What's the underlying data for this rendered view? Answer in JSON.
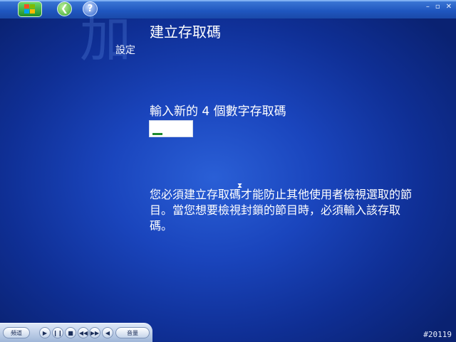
{
  "header": {
    "title": "建立存取碼",
    "section": "設定",
    "watermark": "加"
  },
  "form": {
    "prompt": "輸入新的 4 個數字存取碼",
    "code_value": ""
  },
  "description": "您必須建立存取碼才能防止其他使用者檢視選取的節目。當您想要檢視封鎖的節目時，必須輸入該存取碼。",
  "window_controls": {
    "minimize": "–",
    "restore": "▫",
    "close": "✕"
  },
  "transport": {
    "channel_label": "頻道",
    "volume_label": "音量"
  },
  "counter": "#20119",
  "colors": {
    "accent": "#1a45bd",
    "start_green": "#1f8f2a"
  }
}
